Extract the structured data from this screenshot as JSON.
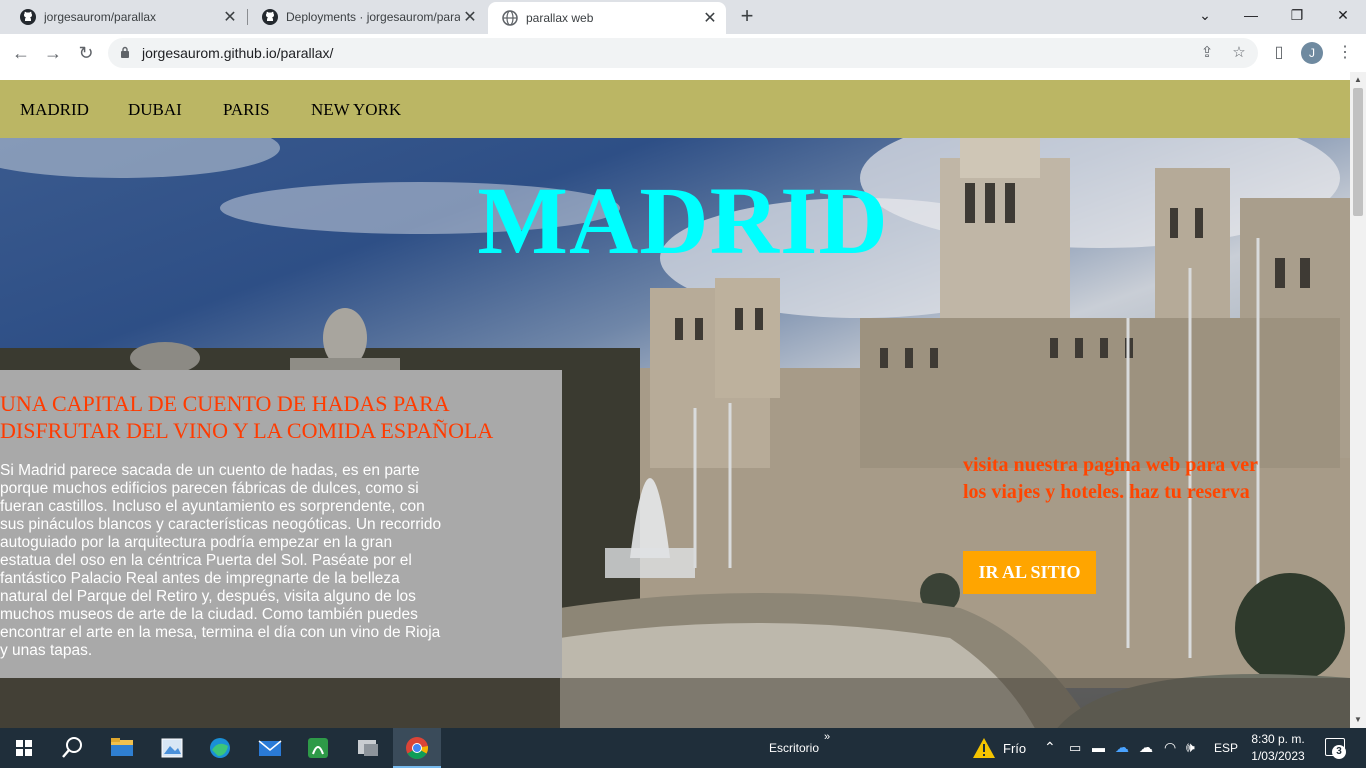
{
  "browser": {
    "tabs": [
      {
        "title": "jorgesaurom/parallax",
        "icon": "github-icon"
      },
      {
        "title": "Deployments · jorgesaurom/para",
        "icon": "github-icon"
      },
      {
        "title": "parallax web",
        "icon": "globe-icon",
        "active": true
      }
    ],
    "url": "jorgesaurom.github.io/parallax/",
    "profile_initial": "J"
  },
  "site": {
    "nav": [
      "MADRID",
      "DUBAI",
      "PARIS",
      "NEW YORK"
    ],
    "hero_title": "MADRID",
    "info_heading": "UNA CAPITAL DE CUENTO DE HADAS PARA DISFRUTAR DEL VINO Y LA COMIDA ESPAÑOLA",
    "info_body": "Si Madrid parece sacada de un cuento de hadas, es en parte porque muchos edificios parecen fábricas de dulces, como si fueran castillos. Incluso el ayuntamiento es sorprendente, con sus pináculos blancos y características neogóticas. Un recorrido autoguiado por la arquitectura podría empezar en la gran estatua del oso en la céntrica Puerta del Sol. Paséate por el fantástico Palacio Real antes de impregnarte de la belleza natural del Parque del Retiro y, después, visita alguno de los muchos museos de arte de la ciudad. Como también puedes encontrar el arte en la mesa, termina el día con un vino de Rioja y unas tapas.",
    "promo_text": "visita nuestra pagina web para ver los viajes y hoteles. haz tu reserva",
    "cta_label": "IR AL SITIO",
    "colors": {
      "nav_bg": "#bbb664",
      "title": "#00ffff",
      "heading": "#ff3b00",
      "cta_bg": "#ffa500"
    }
  },
  "taskbar": {
    "desktop_label": "Escritorio",
    "weather": "Frío",
    "language": "ESP",
    "time": "8:30 p. m.",
    "date": "1/03/2023",
    "notifications": "3"
  }
}
